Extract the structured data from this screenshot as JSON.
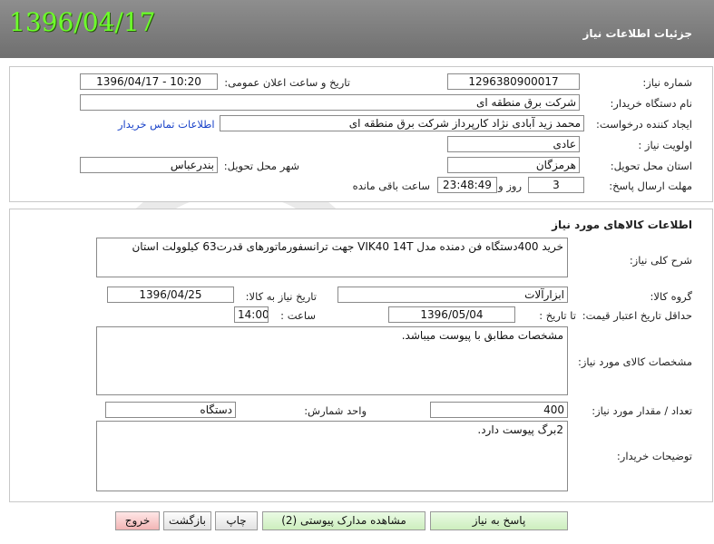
{
  "header": {
    "date": "1396/04/17",
    "title": "جزئیات اطلاعات نیاز"
  },
  "info": {
    "need_number_label": "شماره نیاز:",
    "need_number": "1296380900017",
    "announce_label": "تاریخ و ساعت اعلان عمومی:",
    "announce_value": "1396/04/17 - 10:20",
    "buyer_label": "نام دستگاه خریدار:",
    "buyer": "شرکت برق منطقه ای",
    "creator_label": "ایجاد کننده درخواست:",
    "creator": "محمد زید آبادی نژاد کارپرداز شرکت برق منطقه ای",
    "contact_link": "اطلاعات تماس خریدار",
    "priority_label": "اولویت نیاز :",
    "priority": "عادی",
    "province_label": "استان محل تحویل:",
    "province": "هرمزگان",
    "city_label": "شهر محل تحویل:",
    "city": "بندرعباس",
    "deadline_label": "مهلت ارسال پاسخ:",
    "days": "3",
    "days_suffix": "روز و",
    "time_left": "23:48:49",
    "time_left_suffix": "ساعت باقی مانده"
  },
  "goods": {
    "section_title": "اطلاعات کالاهای مورد نیاز",
    "summary_label": "شرح کلی نیاز:",
    "summary": "خرید 400دستگاه فن دمنده مدل VIK40 14T جهت ترانسفورماتورهای قدرت63 کیلوولت استان",
    "group_label": "گروه کالا:",
    "group": "ابزارآلات",
    "need_date_label": "تاریخ نیاز به کالا:",
    "need_date": "1396/04/25",
    "min_validity_label": "حداقل تاریخ اعتبار قیمت:",
    "until_date_label": "تا تاریخ :",
    "until_date": "1396/05/04",
    "time_label": "ساعت :",
    "time": "14:00",
    "specs_label": "مشخصات کالای مورد نیاز:",
    "specs": "مشخصات مطابق با پیوست میباشد.",
    "qty_label": "تعداد / مقدار مورد نیاز:",
    "qty": "400",
    "unit_label": "واحد شمارش:",
    "unit": "دستگاه",
    "buyer_notes_label": "توضیحات خریدار:",
    "buyer_notes": "2برگ پیوست دارد."
  },
  "buttons": {
    "reply": "پاسخ به نیاز",
    "attachments": "مشاهده مدارک پیوستی (2)",
    "print": "چاپ",
    "back": "بازگشت",
    "exit": "خروج"
  },
  "colors": {
    "header_bg": "#7f7f7f",
    "header_date": "#6dff2a",
    "link": "#1a43c9"
  }
}
